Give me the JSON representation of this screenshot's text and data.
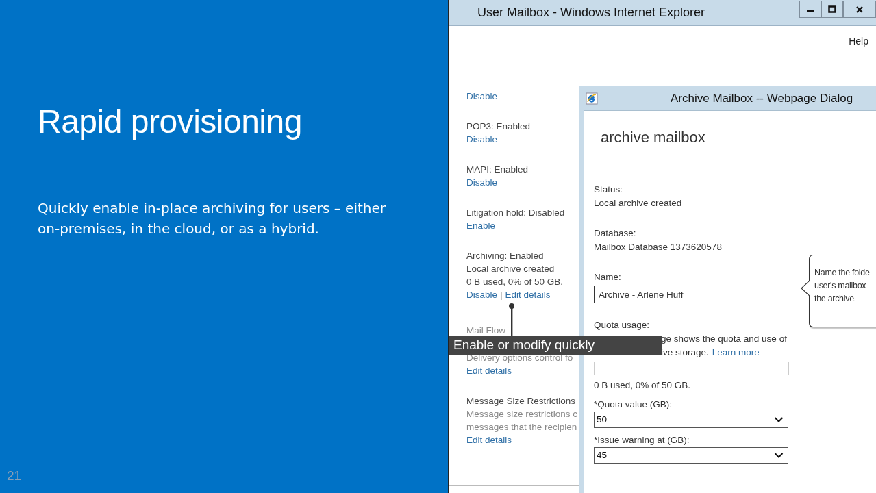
{
  "slide": {
    "title": "Rapid provisioning",
    "body": "Quickly enable in-place archiving for users – either on-premises, in the cloud, or as a hybrid.",
    "page_number": "21"
  },
  "browser_window": {
    "title": "User Mailbox - Windows Internet Explorer",
    "menu": [
      "Help"
    ],
    "sections": [
      {
        "links": [
          "Disable"
        ]
      },
      {
        "lines": [
          {
            "text": "POP3: Enabled",
            "kind": "heading"
          }
        ],
        "links": [
          "Disable"
        ]
      },
      {
        "lines": [
          {
            "text": "MAPI: Enabled",
            "kind": "heading"
          }
        ],
        "links": [
          "Disable"
        ]
      },
      {
        "lines": [
          {
            "text": "Litigation hold: Disabled",
            "kind": "heading"
          }
        ],
        "links": [
          "Enable"
        ]
      },
      {
        "lines": [
          {
            "text": "Archiving: Enabled",
            "kind": "heading"
          },
          {
            "text": "Local archive created",
            "kind": "heading"
          },
          {
            "text": "0 B used, 0% of 50 GB.",
            "kind": "heading"
          }
        ],
        "links": [
          "Disable",
          "Edit details"
        ],
        "separator": "|"
      },
      {
        "lines": [
          {
            "text": "Mail Flow",
            "kind": "description"
          },
          {
            "text": "Delivery options control fo",
            "kind": "description"
          }
        ],
        "links": [
          "Edit details"
        ]
      },
      {
        "lines": [
          {
            "text": "Message Size Restrictions",
            "kind": "heading"
          },
          {
            "text": "Message size restrictions c",
            "kind": "description"
          },
          {
            "text": "messages that the recipien",
            "kind": "description"
          }
        ],
        "links": [
          "Edit details"
        ]
      }
    ]
  },
  "dialog": {
    "title": "Archive Mailbox -- Webpage Dialog",
    "heading": "archive mailbox",
    "status": {
      "label": "Status:",
      "value": "Local archive created"
    },
    "database": {
      "label": "Database:",
      "value": "Mailbox Database 1373620578"
    },
    "name": {
      "label": "Name:",
      "value": "Archive - Arlene Huff"
    },
    "quota_usage": {
      "label": "Quota usage:",
      "description": [
        "ge shows the quota and use of",
        "ive storage."
      ],
      "link": "Learn more",
      "level": 0,
      "reading": "0 B used, 0% of 50 GB."
    },
    "selects": [
      {
        "label": "*Quota value (GB):",
        "value": "50"
      },
      {
        "label": "*Issue warning at (GB):",
        "value": "45"
      }
    ],
    "tooltip": [
      "Name the folde",
      "user's mailbox",
      "the archive."
    ]
  },
  "callout": "Enable or modify quickly"
}
